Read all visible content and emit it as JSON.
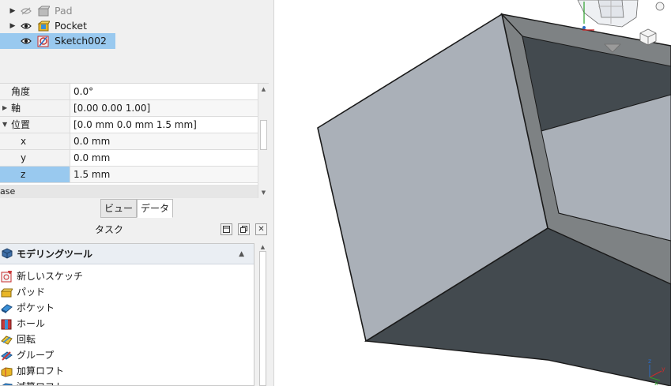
{
  "tree": {
    "items": [
      {
        "label": "Pad",
        "visible": false
      },
      {
        "label": "Pocket",
        "visible": true
      },
      {
        "label": "Sketch002",
        "visible": true,
        "selected": true
      }
    ]
  },
  "properties": {
    "rows": [
      {
        "name": "角度",
        "value": "0.0°"
      },
      {
        "name": "軸",
        "value": "[0.00 0.00 1.00]"
      },
      {
        "name": "位置",
        "value": "[0.0 mm 0.0 mm 1.5 mm]"
      },
      {
        "name": "x",
        "value": "0.0 mm"
      },
      {
        "name": "y",
        "value": "0.0 mm"
      },
      {
        "name": "z",
        "value": "1.5 mm"
      }
    ],
    "group_label": "ase"
  },
  "tabs": [
    "ビュー",
    "データ"
  ],
  "task_panel": {
    "title": "タスク",
    "section_header": "モデリングツール",
    "items": [
      "新しいスケッチ",
      "パッド",
      "ポケット",
      "ホール",
      "回転",
      "グループ",
      "加算ロフト",
      "減算ロフト"
    ]
  },
  "colors": {
    "selection": "#99c9ef",
    "face_light": "#aab0b8",
    "face_dark": "#434a4f",
    "face_mid": "#7e8284",
    "edge": "#1a1a1a"
  },
  "icons": [
    "eye-icon",
    "eye-closed-icon",
    "pad-icon",
    "pocket-icon",
    "sketch-icon",
    "part-design-icon",
    "nav-cube",
    "axis-cross"
  ]
}
